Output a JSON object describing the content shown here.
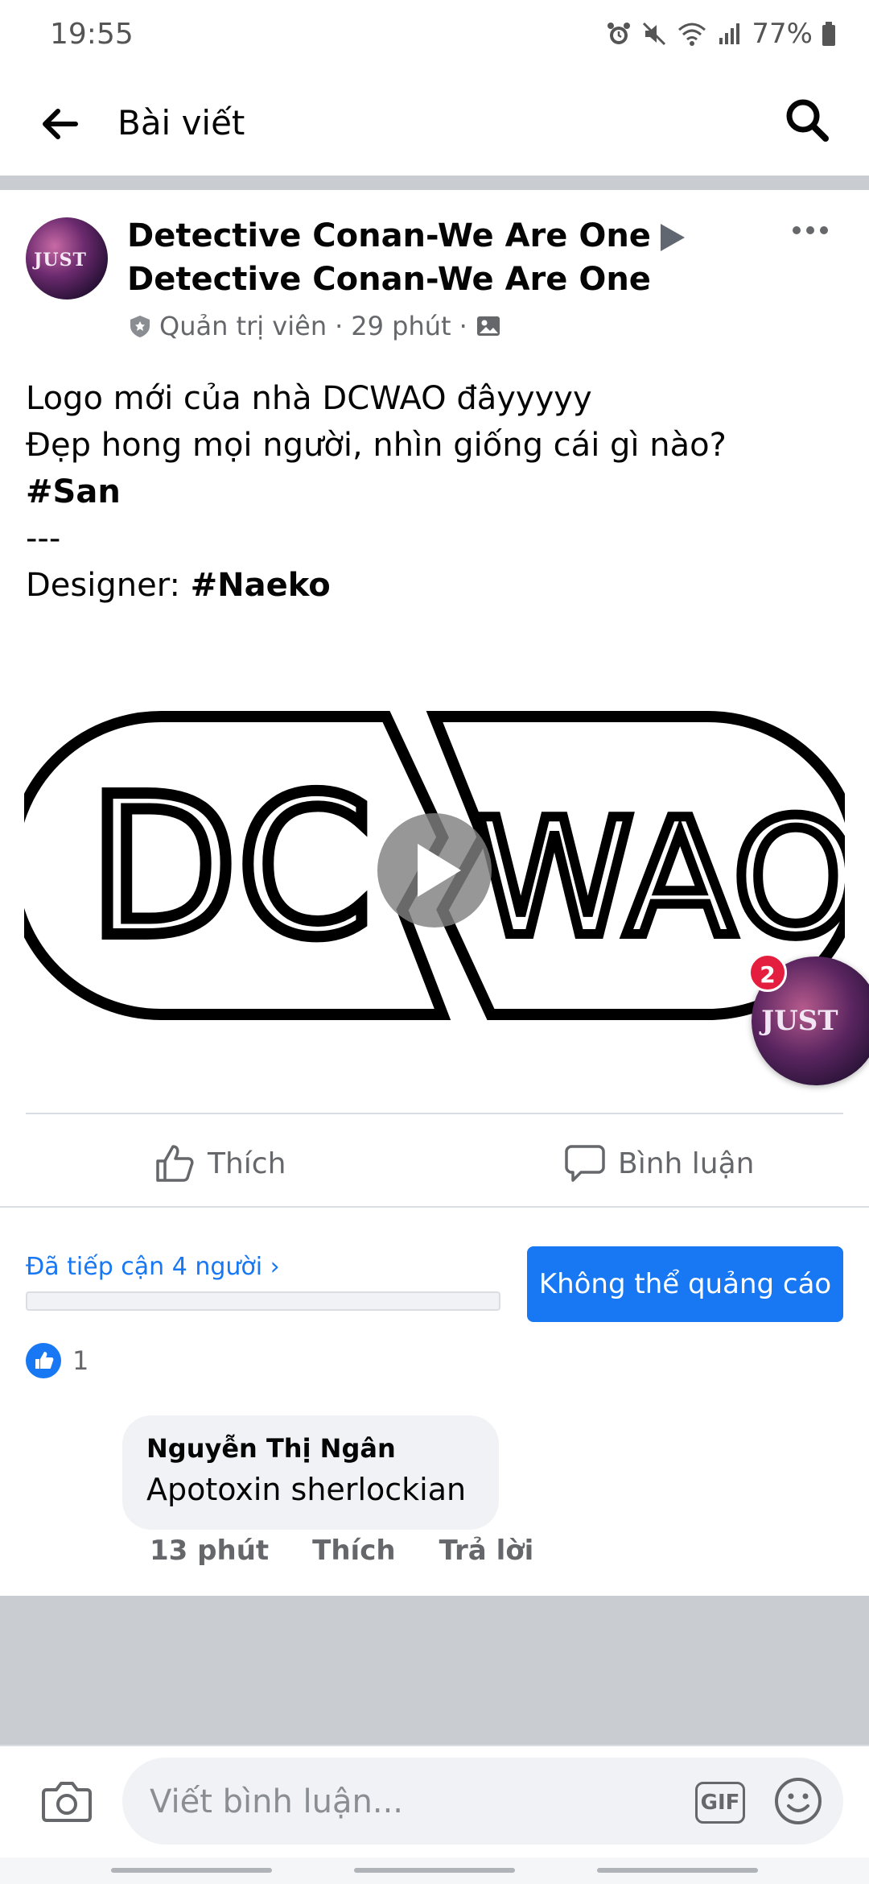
{
  "status_bar": {
    "time": "19:55",
    "battery": "77%"
  },
  "top_bar": {
    "title": "Bài viết"
  },
  "post": {
    "page_name_line1": "Detective Conan-We Are One",
    "page_name_line2": "Detective Conan-We Are One",
    "avatar_text": "JUST",
    "role": "Quản trị viên",
    "dot": "·",
    "time": "29 phút",
    "text_line1": "Logo mới của nhà DCWAO đâyyyyy",
    "text_line2": "Đẹp hong mọi người, nhìn giống cái gì nào?",
    "text_line3": "#San",
    "text_line4": "---",
    "text_line5_prefix": "Designer: ",
    "text_line5_tag": "#Naeko"
  },
  "media": {
    "logo_text_left": "DC",
    "logo_text_right": "WAO"
  },
  "chathead": {
    "badge_count": "2",
    "text": "JUST"
  },
  "actions": {
    "like_label": "Thích",
    "comment_label": "Bình luận"
  },
  "reach": {
    "label": "Đã tiếp cận 4 người",
    "chevron": "›",
    "boost_button": "Không thể quảng cáo"
  },
  "reactions": {
    "count": "1"
  },
  "comment": {
    "author": "Nguyễn Thị Ngân",
    "text": "Apotoxin sherlockian",
    "time": "13 phút",
    "like": "Thích",
    "reply": "Trả lời"
  },
  "composer": {
    "placeholder": "Viết bình luận...",
    "gif_label": "GIF"
  },
  "colors": {
    "accent": "#1877f2",
    "divider": "#c9ccd1",
    "secondary_text": "#65676b",
    "badge": "#e41e3f"
  }
}
